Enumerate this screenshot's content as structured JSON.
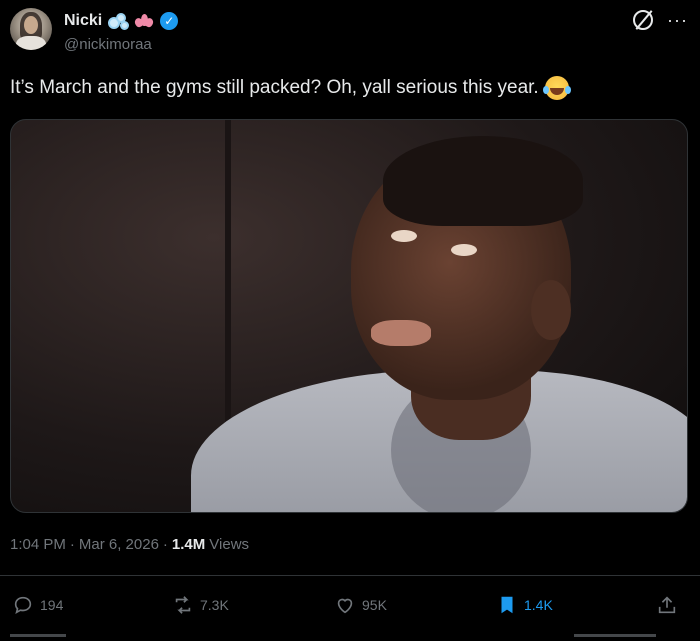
{
  "author": {
    "display_name": "Nicki",
    "handle": "@nickimoraa",
    "verified": true,
    "name_emojis": [
      "bubbles-emoji",
      "lotus-emoji"
    ]
  },
  "tweet": {
    "text": "It’s March and the gyms still packed? Oh, yall serious this year.",
    "trailing_emoji": "face-with-tears-of-joy"
  },
  "meta": {
    "time": "1:04 PM",
    "separator1": "·",
    "date": "Mar 6, 2026",
    "separator2": "·",
    "views_count": "1.4M",
    "views_label": "Views"
  },
  "actions": {
    "replies": "194",
    "reposts": "7.3K",
    "likes": "95K",
    "bookmarks": "1.4K"
  },
  "colors": {
    "background": "#000000",
    "text": "#e7e9ea",
    "muted": "#71767b",
    "accent": "#1d9bf0",
    "divider": "#2f3336"
  }
}
